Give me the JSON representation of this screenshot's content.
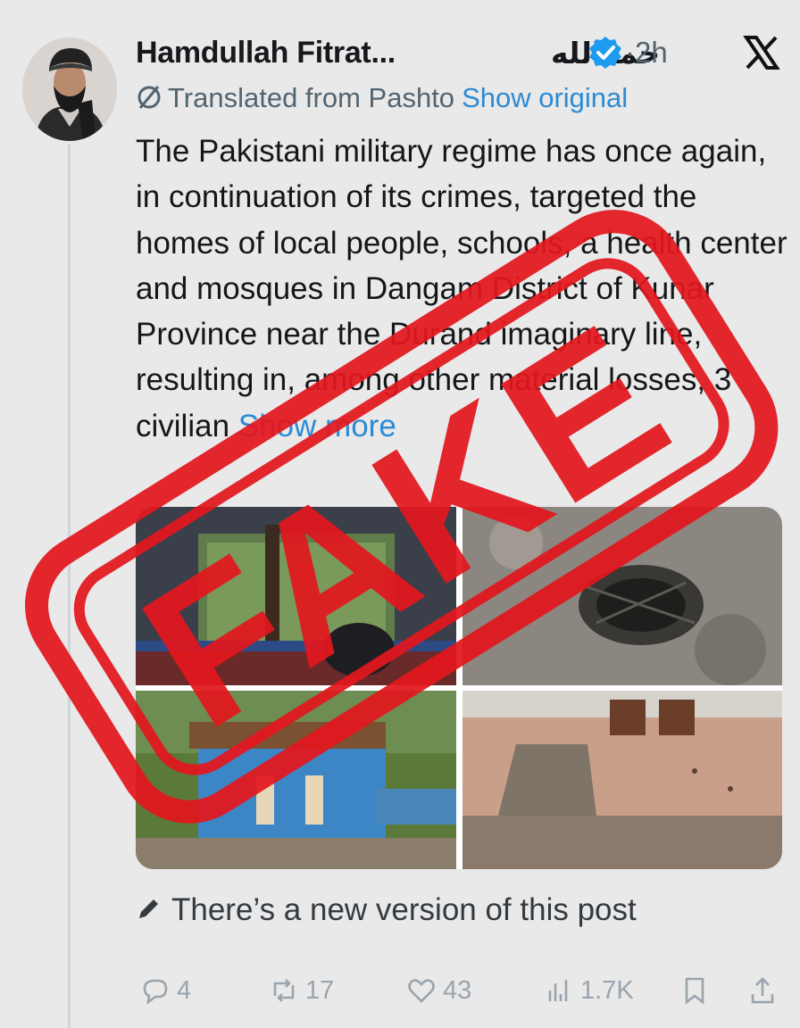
{
  "author": {
    "display_name": "Hamdullah Fitrat...",
    "display_name_arabic": "حمدالله",
    "time_ago": "2h"
  },
  "translation": {
    "label": "Translated from Pashto",
    "show_original": "Show original"
  },
  "tweet": {
    "text": "The Pakistani military regime has once again, in continuation of its crimes, targeted the homes of local people, schools, a health center and mosques in Dangam District of Kunar Province near the Durand imaginary line, resulting in, among other material losses, 3 civilian",
    "show_more": "Show more"
  },
  "edit_notice": "There’s a new version of this post",
  "stats": {
    "replies": "4",
    "reposts": "17",
    "likes": "43",
    "views": "1.7K"
  },
  "stamp": {
    "text": "FAKE",
    "color": "#e3171e"
  },
  "colors": {
    "link": "#2b8bd6",
    "muted": "#536471",
    "verified": "#1d9bf0"
  },
  "icons": [
    "verified-badge-icon",
    "x-logo-icon",
    "translate-icon",
    "pencil-icon",
    "reply-icon",
    "repost-icon",
    "like-icon",
    "views-icon",
    "bookmark-icon",
    "share-icon"
  ]
}
